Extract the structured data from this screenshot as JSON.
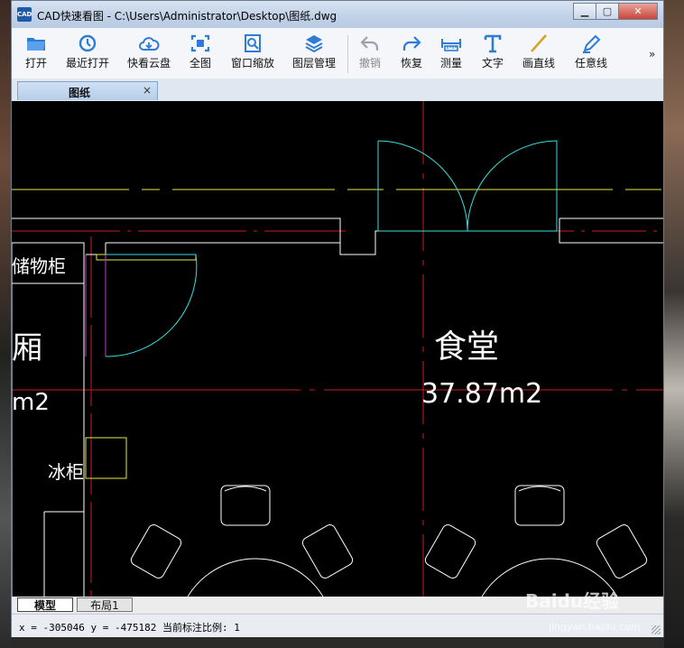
{
  "window": {
    "app_icon": "CAD",
    "title": "CAD快速看图 - C:\\Users\\Administrator\\Desktop\\图纸.dwg",
    "minimize_icon": "minimize-icon",
    "maximize_icon": "maximize-icon",
    "close_icon": "close-icon"
  },
  "toolbar": {
    "open": "打开",
    "recent": "最近打开",
    "cloud": "快看云盘",
    "fullview": "全图",
    "window_zoom": "窗口缩放",
    "layers": "图层管理",
    "undo": "撤销",
    "redo": "恢复",
    "measure": "测量",
    "text": "文字",
    "line": "画直线",
    "freehand": "任意线",
    "more": "»"
  },
  "doc_tab": {
    "label": "图纸",
    "close": "×"
  },
  "drawing": {
    "room1_name": "食堂",
    "room1_area": "37.87m2",
    "left_label_cabinet": "储物柜",
    "left_label_room": "厢",
    "left_label_area": "m2",
    "fridge_label": "冰柜"
  },
  "layout_tabs": {
    "model": "模型",
    "layout1": "布局1"
  },
  "status": {
    "coords": "x = -305046  y = -475182",
    "scale_label": "当前标注比例:",
    "scale_value": "1"
  },
  "watermark": {
    "brand": "Baidu经验",
    "url": "jingyan.baidu.com"
  },
  "colors": {
    "accent": "#2f7cd6",
    "canvas_bg": "#000000",
    "wall": "#ffffff",
    "axis": "#c81e1e",
    "door": "#35e0e0",
    "yellow": "#e8e84a",
    "magenta": "#c040c0"
  }
}
